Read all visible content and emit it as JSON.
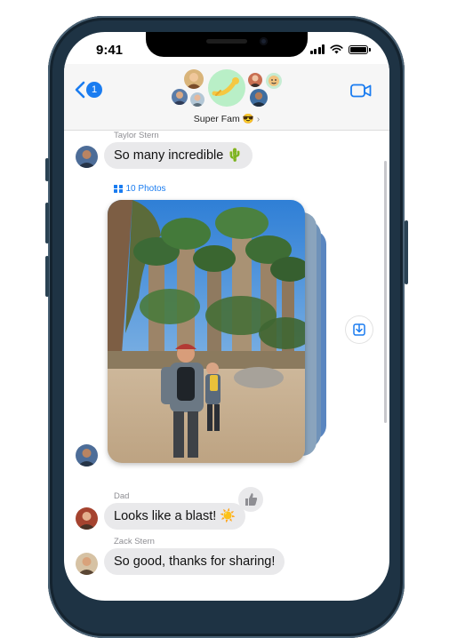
{
  "status_bar": {
    "time": "9:41"
  },
  "header": {
    "back_badge": "1",
    "group_name": "Super Fam 😎",
    "accent_color": "#1a7cf0"
  },
  "messages": [
    {
      "sender": "Taylor Stern",
      "text": "So many incredible 🌵"
    },
    {
      "sender": "Dad",
      "text": "Looks like a blast! ☀️"
    },
    {
      "sender": "Zack Stern",
      "text": "So good, thanks for sharing!"
    }
  ],
  "photo_stack": {
    "label": "10 Photos"
  },
  "icons": {
    "back": "chevron-left-icon",
    "video": "video-camera-icon",
    "save": "save-to-library-icon",
    "tapback": "thumbs-up-icon"
  }
}
